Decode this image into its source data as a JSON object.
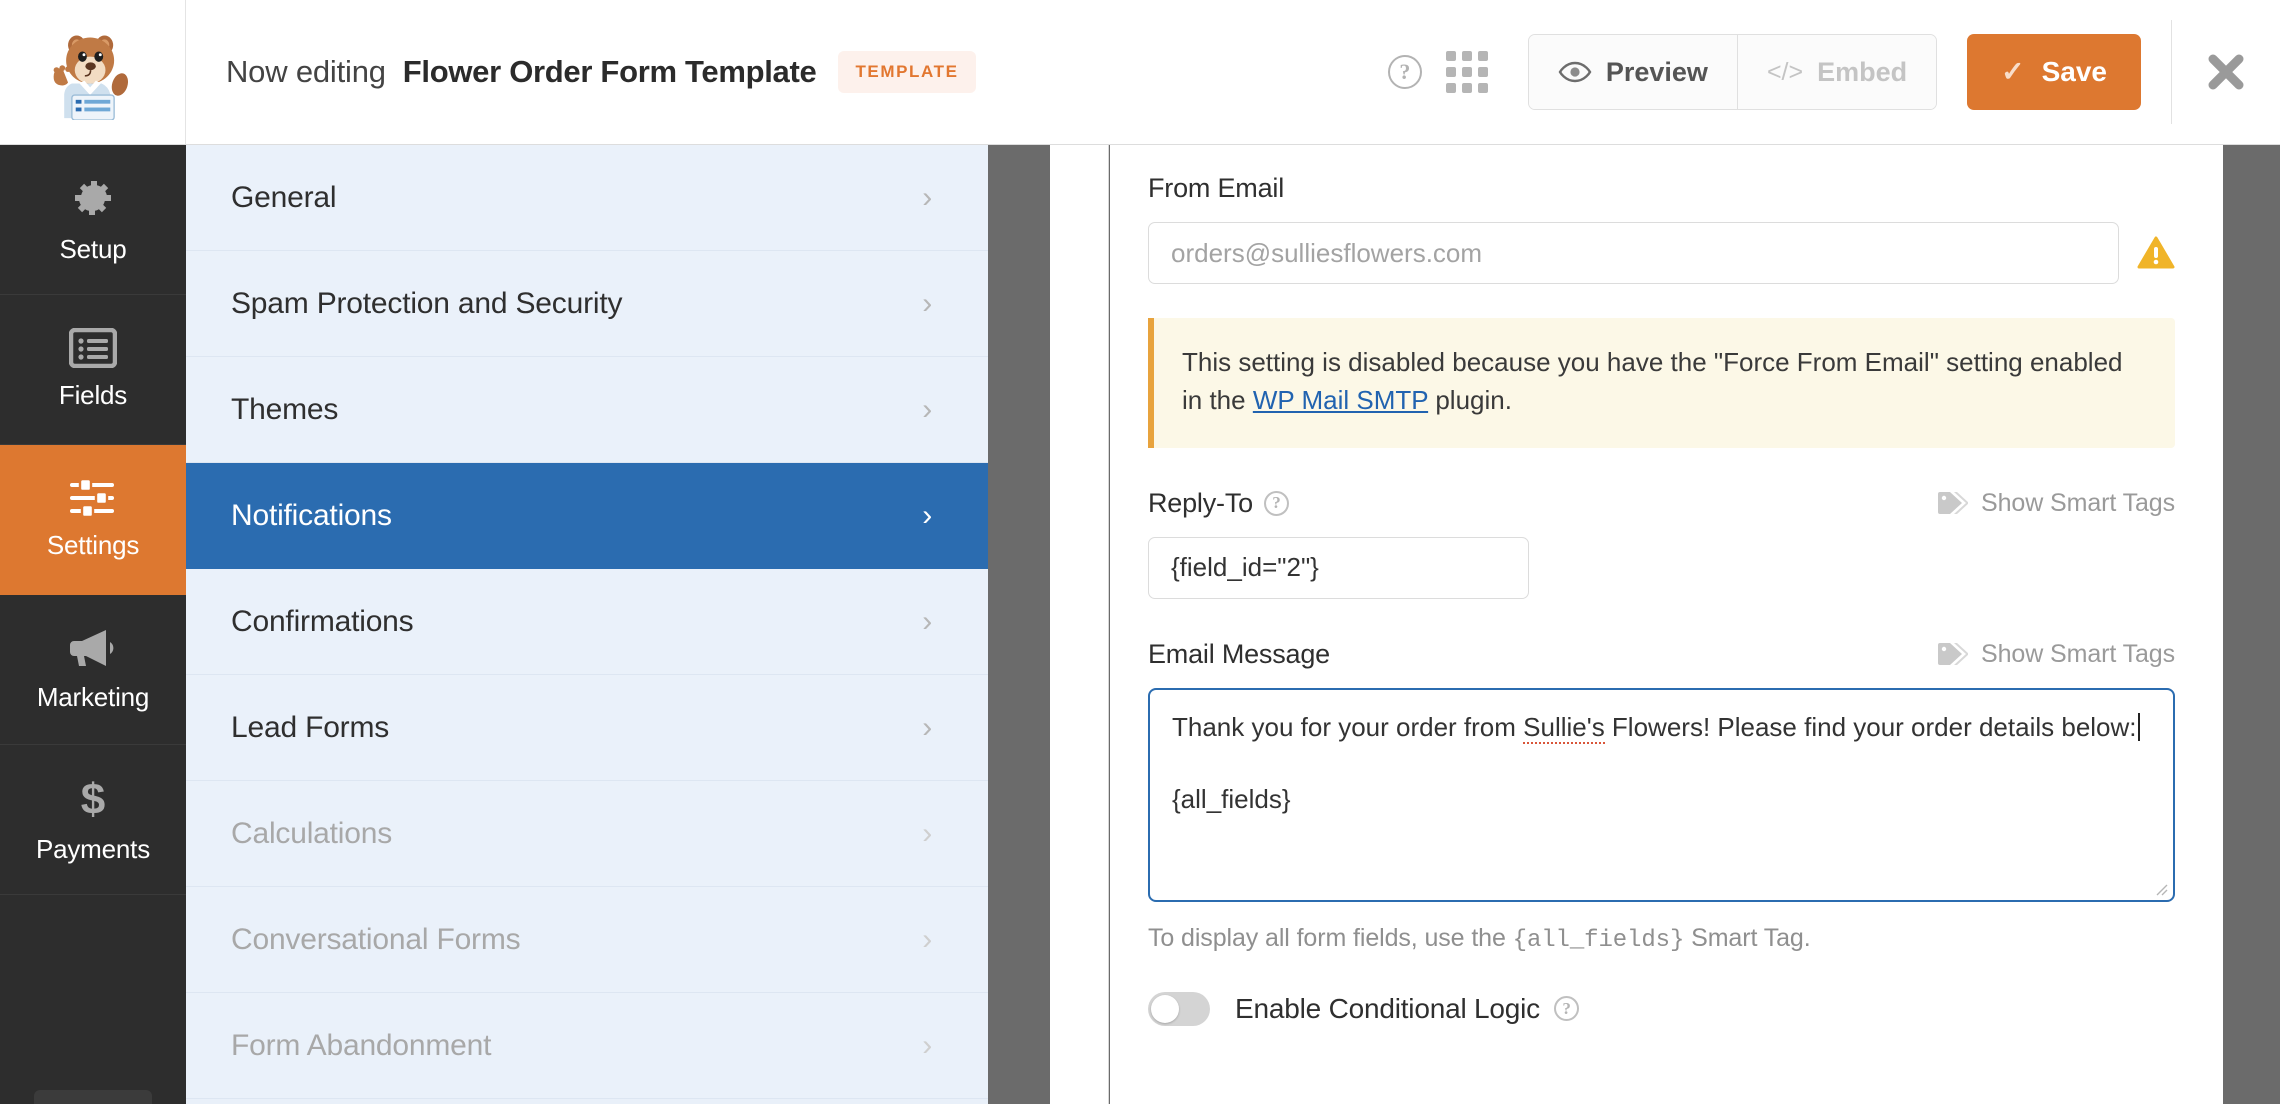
{
  "header": {
    "now_editing_label": "Now editing",
    "form_title": "Flower Order Form Template",
    "template_badge": "TEMPLATE",
    "help_icon": "help-circle-icon",
    "apps_icon": "grid-dots-icon",
    "preview_label": "Preview",
    "embed_label": "Embed",
    "save_label": "Save",
    "close_icon": "close-x-icon",
    "accent_orange": "#dd7830",
    "badge_bg": "#fdf1ec"
  },
  "rail": {
    "items": [
      {
        "label": "Setup",
        "icon": "gear-icon",
        "active": false
      },
      {
        "label": "Fields",
        "icon": "list-icon",
        "active": false
      },
      {
        "label": "Settings",
        "icon": "sliders-icon",
        "active": true
      },
      {
        "label": "Marketing",
        "icon": "megaphone-icon",
        "active": false
      },
      {
        "label": "Payments",
        "icon": "dollar-icon",
        "active": false
      }
    ]
  },
  "settings_list": {
    "items": [
      {
        "label": "General",
        "state": "normal"
      },
      {
        "label": "Spam Protection and Security",
        "state": "normal"
      },
      {
        "label": "Themes",
        "state": "normal"
      },
      {
        "label": "Notifications",
        "state": "active"
      },
      {
        "label": "Confirmations",
        "state": "normal"
      },
      {
        "label": "Lead Forms",
        "state": "normal"
      },
      {
        "label": "Calculations",
        "state": "disabled"
      },
      {
        "label": "Conversational Forms",
        "state": "disabled"
      },
      {
        "label": "Form Abandonment",
        "state": "disabled"
      }
    ],
    "active_bg": "#2b6cb0",
    "panel_bg": "#eaf1fa"
  },
  "notification_settings": {
    "from_email": {
      "label": "From Email",
      "value": "",
      "placeholder": "orders@sulliesflowers.com",
      "warning_icon": "warning-triangle-icon"
    },
    "notice": {
      "text_before": "This setting is disabled because you have the \"Force From Email\" setting enabled in the ",
      "link_text": "WP Mail SMTP",
      "text_after": " plugin.",
      "border_color": "#e8a33d",
      "bg": "#fcf8e7"
    },
    "reply_to": {
      "label": "Reply-To",
      "help_icon": "help-circle-icon",
      "smart_tags_label": "Show Smart Tags",
      "smart_tags_icon": "tag-icon",
      "value": "{field_id=\"2\"}"
    },
    "email_message": {
      "label": "Email Message",
      "smart_tags_label": "Show Smart Tags",
      "smart_tags_icon": "tag-icon",
      "line1_a": "Thank you for your order from ",
      "line1_misspelled": "Sullie's",
      "line1_b": " Flowers! Please find your order details below:",
      "line2": "{all_fields}",
      "focused": true
    },
    "hint": {
      "before": "To display all form fields, use the ",
      "code": "{all_fields}",
      "after": " Smart Tag."
    },
    "conditional_logic": {
      "label": "Enable Conditional Logic",
      "enabled": false,
      "help_icon": "help-circle-icon"
    }
  }
}
